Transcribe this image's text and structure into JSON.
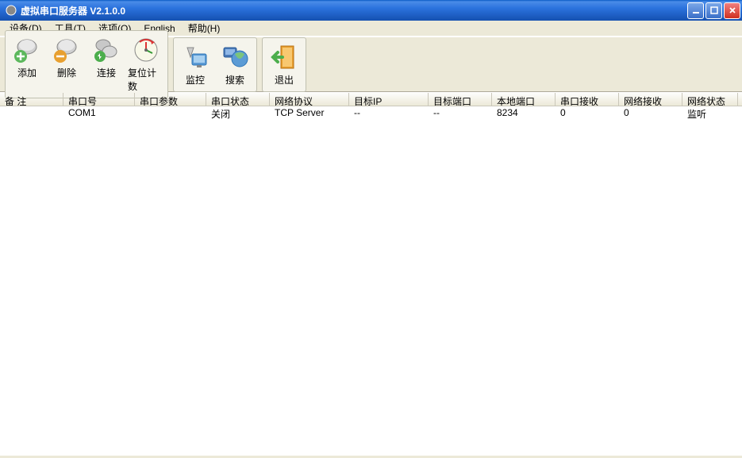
{
  "window": {
    "title": "虚拟串口服务器  V2.1.0.0"
  },
  "menu": {
    "device": "设备(D)",
    "tools": "工具(T)",
    "options": "选项(O)",
    "english": "English",
    "help": "帮助(H)"
  },
  "toolbar": {
    "add": "添加",
    "delete": "删除",
    "connect": "连接",
    "reset_count": "复位计数",
    "monitor": "监控",
    "search": "搜索",
    "exit": "退出"
  },
  "columns": {
    "remark": "备 注",
    "port_no": "串口号",
    "port_params": "串口参数",
    "port_status": "串口状态",
    "net_protocol": "网络协议",
    "target_ip": "目标IP",
    "target_port": "目标端口",
    "local_port": "本地端口",
    "port_recv": "串口接收",
    "net_recv": "网络接收",
    "net_status": "网络状态"
  },
  "rows": [
    {
      "remark": "",
      "port_no": "COM1",
      "port_params": "",
      "port_status": "关闭",
      "net_protocol": "TCP Server",
      "target_ip": "--",
      "target_port": "--",
      "local_port": "8234",
      "port_recv": "0",
      "net_recv": "0",
      "net_status": "监听"
    }
  ]
}
